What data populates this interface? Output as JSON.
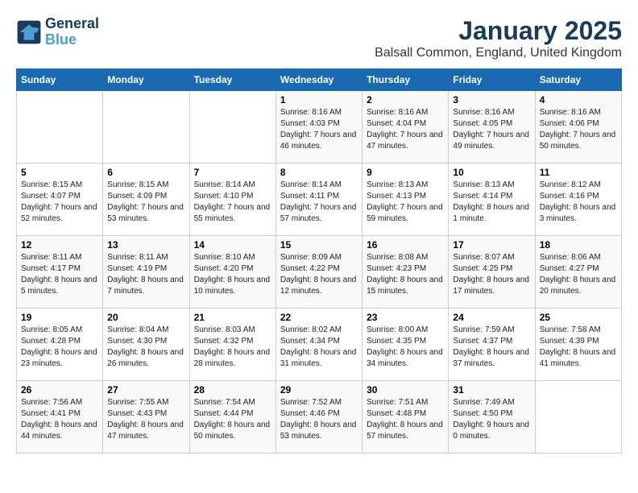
{
  "logo": {
    "line1": "General",
    "line2": "Blue"
  },
  "title": "January 2025",
  "subtitle": "Balsall Common, England, United Kingdom",
  "weekdays": [
    "Sunday",
    "Monday",
    "Tuesday",
    "Wednesday",
    "Thursday",
    "Friday",
    "Saturday"
  ],
  "weeks": [
    [
      {
        "day": "",
        "info": ""
      },
      {
        "day": "",
        "info": ""
      },
      {
        "day": "",
        "info": ""
      },
      {
        "day": "1",
        "info": "Sunrise: 8:16 AM\nSunset: 4:03 PM\nDaylight: 7 hours and 46 minutes."
      },
      {
        "day": "2",
        "info": "Sunrise: 8:16 AM\nSunset: 4:04 PM\nDaylight: 7 hours and 47 minutes."
      },
      {
        "day": "3",
        "info": "Sunrise: 8:16 AM\nSunset: 4:05 PM\nDaylight: 7 hours and 49 minutes."
      },
      {
        "day": "4",
        "info": "Sunrise: 8:16 AM\nSunset: 4:06 PM\nDaylight: 7 hours and 50 minutes."
      }
    ],
    [
      {
        "day": "5",
        "info": "Sunrise: 8:15 AM\nSunset: 4:07 PM\nDaylight: 7 hours and 52 minutes."
      },
      {
        "day": "6",
        "info": "Sunrise: 8:15 AM\nSunset: 4:09 PM\nDaylight: 7 hours and 53 minutes."
      },
      {
        "day": "7",
        "info": "Sunrise: 8:14 AM\nSunset: 4:10 PM\nDaylight: 7 hours and 55 minutes."
      },
      {
        "day": "8",
        "info": "Sunrise: 8:14 AM\nSunset: 4:11 PM\nDaylight: 7 hours and 57 minutes."
      },
      {
        "day": "9",
        "info": "Sunrise: 8:13 AM\nSunset: 4:13 PM\nDaylight: 7 hours and 59 minutes."
      },
      {
        "day": "10",
        "info": "Sunrise: 8:13 AM\nSunset: 4:14 PM\nDaylight: 8 hours and 1 minute."
      },
      {
        "day": "11",
        "info": "Sunrise: 8:12 AM\nSunset: 4:16 PM\nDaylight: 8 hours and 3 minutes."
      }
    ],
    [
      {
        "day": "12",
        "info": "Sunrise: 8:11 AM\nSunset: 4:17 PM\nDaylight: 8 hours and 5 minutes."
      },
      {
        "day": "13",
        "info": "Sunrise: 8:11 AM\nSunset: 4:19 PM\nDaylight: 8 hours and 7 minutes."
      },
      {
        "day": "14",
        "info": "Sunrise: 8:10 AM\nSunset: 4:20 PM\nDaylight: 8 hours and 10 minutes."
      },
      {
        "day": "15",
        "info": "Sunrise: 8:09 AM\nSunset: 4:22 PM\nDaylight: 8 hours and 12 minutes."
      },
      {
        "day": "16",
        "info": "Sunrise: 8:08 AM\nSunset: 4:23 PM\nDaylight: 8 hours and 15 minutes."
      },
      {
        "day": "17",
        "info": "Sunrise: 8:07 AM\nSunset: 4:25 PM\nDaylight: 8 hours and 17 minutes."
      },
      {
        "day": "18",
        "info": "Sunrise: 8:06 AM\nSunset: 4:27 PM\nDaylight: 8 hours and 20 minutes."
      }
    ],
    [
      {
        "day": "19",
        "info": "Sunrise: 8:05 AM\nSunset: 4:28 PM\nDaylight: 8 hours and 23 minutes."
      },
      {
        "day": "20",
        "info": "Sunrise: 8:04 AM\nSunset: 4:30 PM\nDaylight: 8 hours and 26 minutes."
      },
      {
        "day": "21",
        "info": "Sunrise: 8:03 AM\nSunset: 4:32 PM\nDaylight: 8 hours and 28 minutes."
      },
      {
        "day": "22",
        "info": "Sunrise: 8:02 AM\nSunset: 4:34 PM\nDaylight: 8 hours and 31 minutes."
      },
      {
        "day": "23",
        "info": "Sunrise: 8:00 AM\nSunset: 4:35 PM\nDaylight: 8 hours and 34 minutes."
      },
      {
        "day": "24",
        "info": "Sunrise: 7:59 AM\nSunset: 4:37 PM\nDaylight: 8 hours and 37 minutes."
      },
      {
        "day": "25",
        "info": "Sunrise: 7:58 AM\nSunset: 4:39 PM\nDaylight: 8 hours and 41 minutes."
      }
    ],
    [
      {
        "day": "26",
        "info": "Sunrise: 7:56 AM\nSunset: 4:41 PM\nDaylight: 8 hours and 44 minutes."
      },
      {
        "day": "27",
        "info": "Sunrise: 7:55 AM\nSunset: 4:43 PM\nDaylight: 8 hours and 47 minutes."
      },
      {
        "day": "28",
        "info": "Sunrise: 7:54 AM\nSunset: 4:44 PM\nDaylight: 8 hours and 50 minutes."
      },
      {
        "day": "29",
        "info": "Sunrise: 7:52 AM\nSunset: 4:46 PM\nDaylight: 8 hours and 53 minutes."
      },
      {
        "day": "30",
        "info": "Sunrise: 7:51 AM\nSunset: 4:48 PM\nDaylight: 8 hours and 57 minutes."
      },
      {
        "day": "31",
        "info": "Sunrise: 7:49 AM\nSunset: 4:50 PM\nDaylight: 9 hours and 0 minutes."
      },
      {
        "day": "",
        "info": ""
      }
    ]
  ]
}
